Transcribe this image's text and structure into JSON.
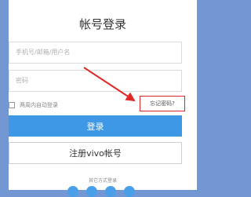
{
  "page": {
    "title": "帐号登录",
    "username_placeholder": "手机号/邮箱/用户名",
    "password_placeholder": "密码",
    "remember_label": "两周内自动登录",
    "forgot_label": "忘记密码?",
    "login_button": "登录",
    "register_button": "注册vivo帐号",
    "other_login_label": "其它方式登录",
    "social_icons": [
      "social-icon-1",
      "social-icon-2",
      "social-icon-3",
      "social-icon-4"
    ]
  },
  "colors": {
    "background": "#7397d3",
    "primary_button": "#3f98e6",
    "highlight_box": "#d9262b",
    "arrow": "#e02a2a"
  }
}
